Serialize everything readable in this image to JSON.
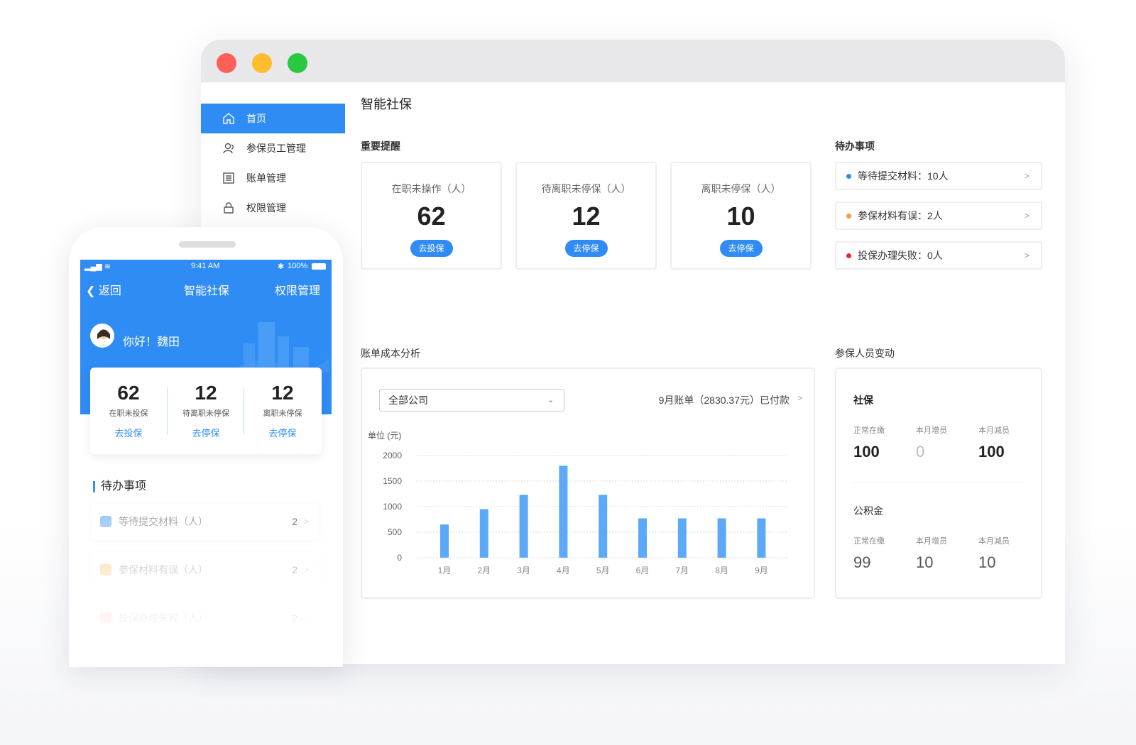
{
  "desktop": {
    "sidebar": [
      {
        "label": "首页",
        "icon": "home-icon",
        "active": true
      },
      {
        "label": "参保员工管理",
        "icon": "users-icon",
        "active": false
      },
      {
        "label": "账单管理",
        "icon": "list-icon",
        "active": false
      },
      {
        "label": "权限管理",
        "icon": "lock-icon",
        "active": false
      }
    ],
    "page_title": "智能社保",
    "reminders": {
      "title": "重要提醒",
      "cards": [
        {
          "label": "在职未操作（人）",
          "value": "62",
          "action": "去投保"
        },
        {
          "label": "待离职未停保（人）",
          "value": "12",
          "action": "去停保"
        },
        {
          "label": "离职未停保（人）",
          "value": "10",
          "action": "去停保"
        }
      ]
    },
    "todo": {
      "title": "待办事项",
      "items": [
        {
          "text": "等待提交材料：10人",
          "color": "#2f8cf4"
        },
        {
          "text": "参保材料有误：2人",
          "color": "#f79a3c"
        },
        {
          "text": "投保办理失败：0人",
          "color": "#e8262c"
        }
      ]
    },
    "cost": {
      "title": "账单成本分析",
      "select": "全部公司",
      "bill": "9月账单（2830.37元）已付款",
      "unit": "单位 (元)"
    },
    "insured": {
      "title": "参保人员变动",
      "social": {
        "name": "社保",
        "labels": [
          "正常在缴",
          "本月增员",
          "本月减员"
        ],
        "values": [
          "100",
          "0",
          "100"
        ]
      },
      "fund": {
        "name": "公积金",
        "labels": [
          "正常在缴",
          "本月增员",
          "本月减员"
        ],
        "values": [
          "99",
          "10",
          "10"
        ]
      }
    }
  },
  "chart_data": {
    "type": "bar",
    "categories": [
      "1月",
      "2月",
      "3月",
      "4月",
      "5月",
      "6月",
      "7月",
      "8月",
      "9月"
    ],
    "values": [
      650,
      950,
      1230,
      1800,
      1230,
      770,
      770,
      770,
      770
    ],
    "ylabel": "单位 (元)",
    "yticks": [
      "0",
      "500",
      "1000",
      "1500",
      "2000"
    ],
    "ylim": [
      0,
      2000
    ],
    "color": "#5ba9f7"
  },
  "phone": {
    "status": {
      "time": "9:41 AM",
      "battery": "100%"
    },
    "nav": {
      "back": "返回",
      "title": "智能社保",
      "right": "权限管理"
    },
    "greeting": "你好！魏田",
    "stats": [
      {
        "value": "62",
        "label": "在职未投保",
        "action": "去投保"
      },
      {
        "value": "12",
        "label": "待离职未停保",
        "action": "去停保"
      },
      {
        "value": "12",
        "label": "离职未停保",
        "action": "去停保"
      }
    ],
    "todo_title": "待办事项",
    "todos": [
      {
        "label": "等待提交材料（人）",
        "count": "2",
        "color": "#7db8f5"
      },
      {
        "label": "参保材料有误（人）",
        "count": "2",
        "color": "#f7c46a"
      },
      {
        "label": "投保办理失败（人）",
        "count": "2",
        "color": "#f29a9a"
      }
    ]
  }
}
